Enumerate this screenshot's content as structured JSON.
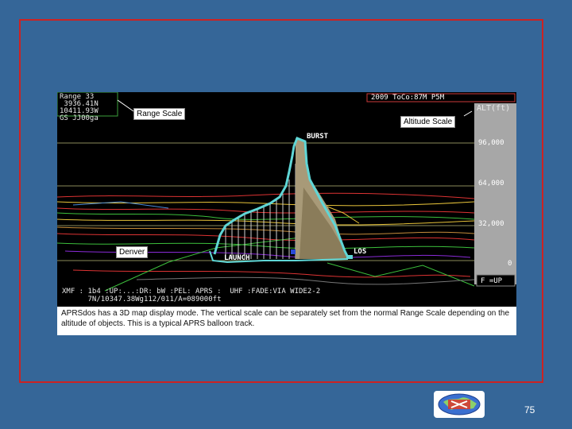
{
  "header": {
    "range_block": [
      "Range 33",
      " 3936.41N",
      "10411.93W",
      "GS JJ00ga"
    ],
    "time_block": "2009 ToCo:87M P5M",
    "alt_heading": "ALT(ft)"
  },
  "callouts": {
    "range_scale": "Range Scale",
    "altitude_scale": "Altitude Scale",
    "denver": "Denver"
  },
  "track_labels": {
    "burst": "BURST",
    "launch": "LAUNCH",
    "los": "LOS"
  },
  "altitude_ticks": [
    "96,000",
    "64,000",
    "32,000",
    "0"
  ],
  "alt_mode": "F =UP",
  "status_lines": [
    "XMF : 1b4 :UP:...:DR: bW :PEL: APRS :  UHF :FADE:VIA WIDE2-2",
    "      7N/10347.38Wg112/011/A=089000ft"
  ],
  "caption": "APRSdos has a 3D map display mode.  The vertical scale can be separately set from the normal Range Scale depending on the altitude of objects.  This is a typical APRS balloon track.",
  "page_number": "75",
  "colors": {
    "slide_bg": "#356698",
    "frame": "#cc2222",
    "track": "#5fd6d6",
    "alt_panel": "#a7a7a7",
    "gridline": "#8a8a5a"
  }
}
